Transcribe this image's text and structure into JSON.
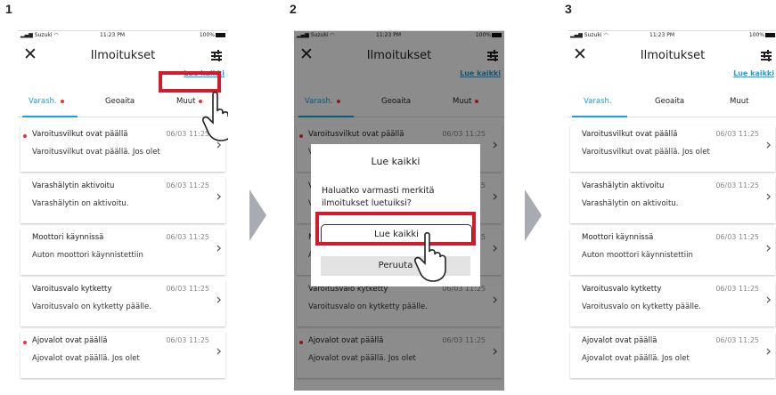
{
  "steps": [
    "1",
    "2",
    "3"
  ],
  "status": {
    "carrier": "Suzuki",
    "time": "11:23 PM",
    "battery": "100%"
  },
  "header": {
    "title": "Ilmoitukset",
    "read_all": "Lue kaikki"
  },
  "tabs": [
    "Varash.",
    "Geoaita",
    "Muut"
  ],
  "notifications": [
    {
      "title": "Varoitusvilkut ovat päällä",
      "date": "06/03 11:25",
      "body": "Varoitusvilkut ovat päällä. Jos olet",
      "unread": true
    },
    {
      "title": "Varashälytin aktivoitu",
      "date": "06/03 11:25",
      "body": "Varashälytin on aktivoitu.",
      "unread": false
    },
    {
      "title": "Moottori käynnissä",
      "date": "06/03 11:25",
      "body": "Auton moottori käynnistettiin",
      "unread": false
    },
    {
      "title": "Varoitusvalo kytketty",
      "date": "06/03 11:25",
      "body": "Varoitusvalo on kytketty päälle.",
      "unread": false
    },
    {
      "title": "Ajovalot ovat päällä",
      "date": "06/03 11:25",
      "body": "Ajovalot ovat päällä. Jos olet",
      "unread": true
    }
  ],
  "dialog": {
    "title": "Lue kaikki",
    "message_line1": "Haluatko varmasti merkitä",
    "message_line2": "ilmoitukset luetuiksi?",
    "confirm": "Lue kaikki",
    "cancel": "Peruuta"
  },
  "colors": {
    "accent": "#1a9fe0",
    "highlight": "#d41b2c",
    "unread_dot": "#e33333",
    "arrow": "#a8acb2"
  }
}
